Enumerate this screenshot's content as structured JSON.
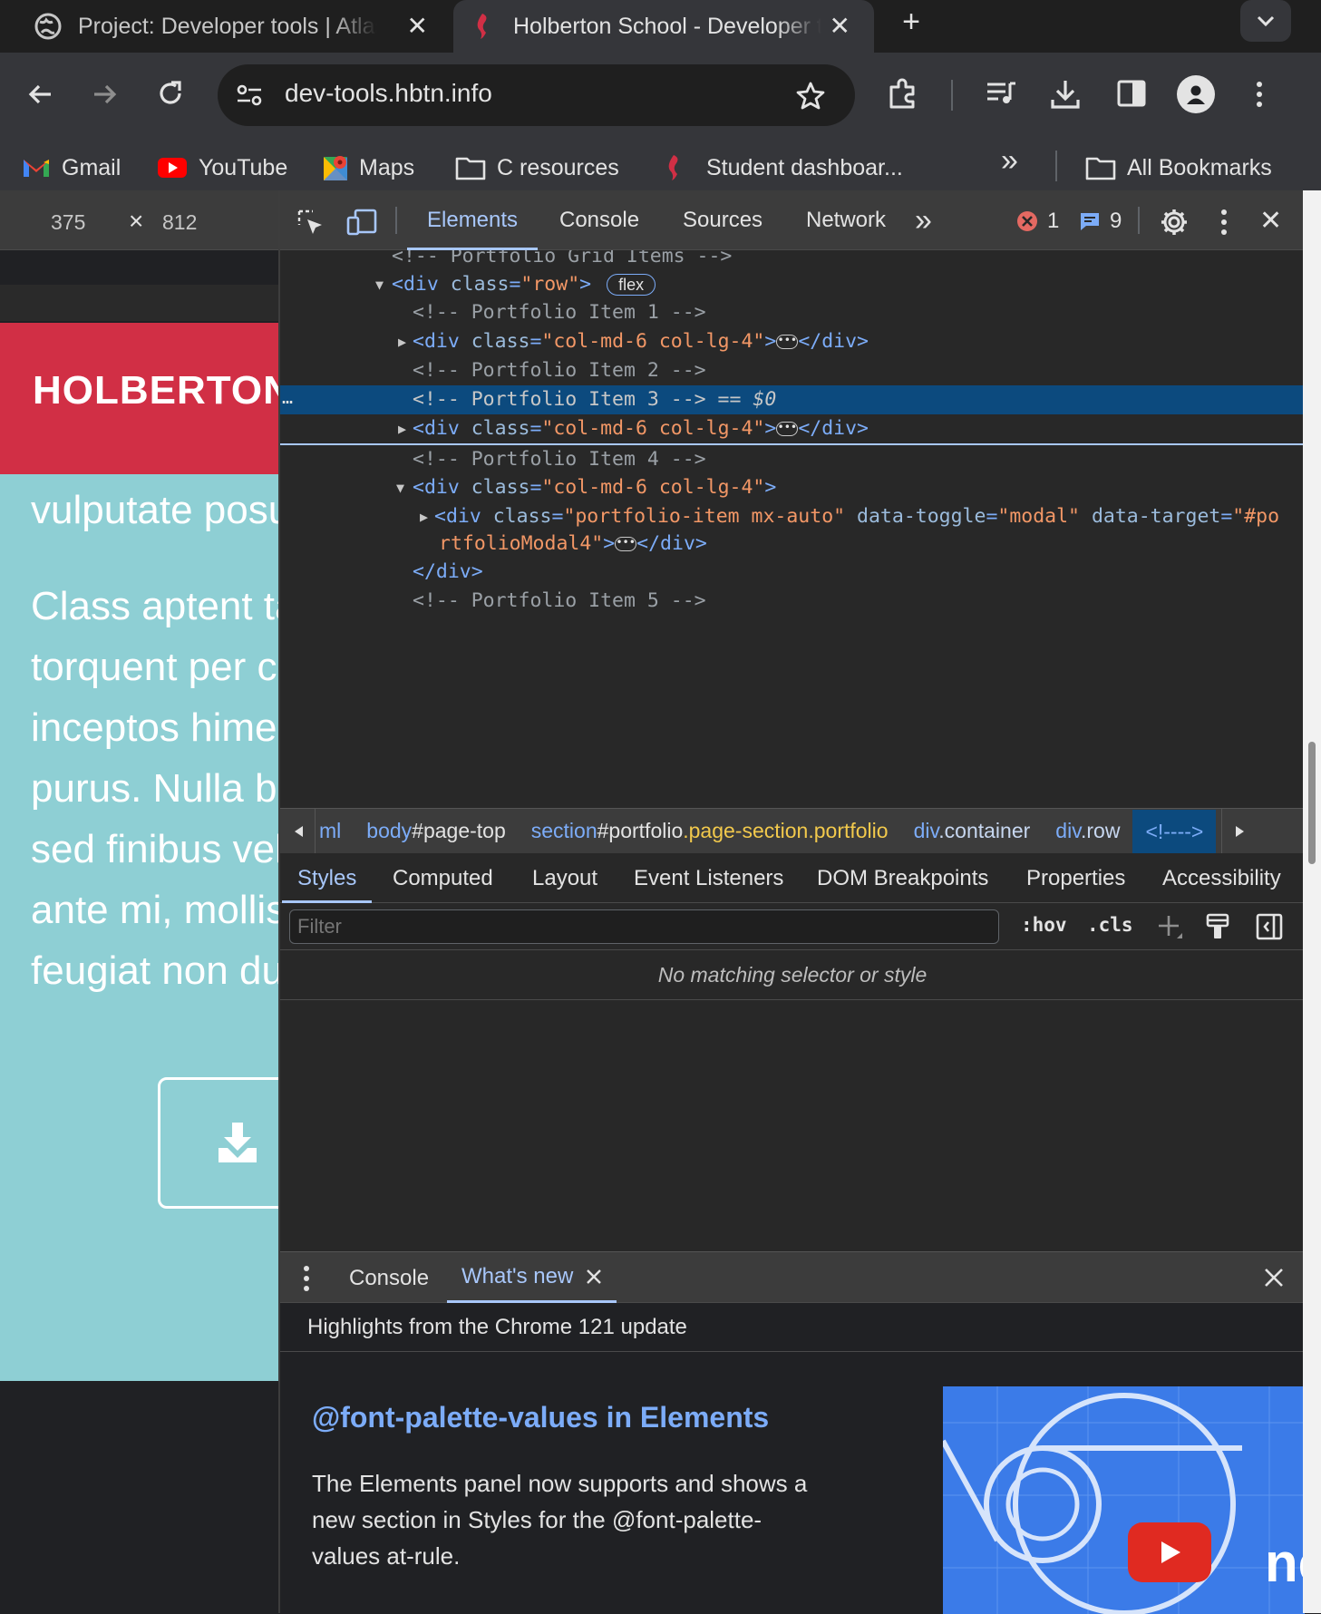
{
  "browser": {
    "tabs": [
      {
        "title": "Project: Developer tools | Atlas",
        "close": "✕"
      },
      {
        "title": "Holberton School - Developer tools",
        "close": "✕"
      }
    ],
    "new_tab": "+",
    "tab_menu": "⌄",
    "url": "dev-tools.hbtn.info",
    "bookmarks": [
      {
        "label": "Gmail",
        "icon": "gmail-icon"
      },
      {
        "label": "YouTube",
        "icon": "youtube-icon"
      },
      {
        "label": "Maps",
        "icon": "maps-icon"
      },
      {
        "label": "C resources",
        "icon": "folder-icon"
      },
      {
        "label": "Student dashboar...",
        "icon": "holberton-icon"
      }
    ],
    "more_bookmarks": "»",
    "all_bookmarks": "All Bookmarks"
  },
  "device_toolbar": {
    "width": "375",
    "times": "×",
    "height": "812"
  },
  "page": {
    "brand": "HOLBERTON",
    "subtitle": "vulputate posu",
    "paragraph_lines": [
      "Class aptent ta",
      "torquent per c",
      "inceptos hime",
      "purus. Nulla bi",
      "sed finibus vel",
      "ante mi, mollis",
      "feugiat non du"
    ]
  },
  "devtools": {
    "tabs": [
      "Elements",
      "Console",
      "Sources",
      "Network"
    ],
    "more_tabs": "»",
    "error_count": "1",
    "message_count": "9",
    "close": "✕",
    "tree": {
      "l0": "<!-- Portfolio Grid Items -->",
      "l1_tag": "<div ",
      "l1_attr": "class",
      "l1_val": "\"row\"",
      "l1_end": ">",
      "l1_badge": "flex",
      "l2": "<!-- Portfolio Item 1 -->",
      "col_tag": "<div ",
      "col_attr": "class",
      "col_val": "\"col-md-6 col-lg-4\"",
      "gt": ">",
      "close_div": "</div>",
      "l4": "<!-- Portfolio Item 2 -->",
      "l5": "<!-- Portfolio Item 3 -->",
      "l5_suffix": " == $0",
      "l7": "<!-- Portfolio Item 4 -->",
      "l9_attr1": "class",
      "l9_val1": "\"portfolio-item mx-auto\"",
      "l9_attr2": "data-toggle",
      "l9_val2": "\"modal\"",
      "l9_attr3": "data-target",
      "l9_val3a": "\"#po",
      "l10_val": "rtfolioModal4\"",
      "l12": "<!-- Portfolio Item 5 -->"
    },
    "breadcrumbs": [
      "ml",
      "body#page-top",
      "section#portfolio.page-section.portfolio",
      "div.container",
      "div.row",
      "<!---->"
    ],
    "crumb_parts": {
      "body_a": "body",
      "body_b": "#page-top",
      "sec_a": "section",
      "sec_b": "#portfolio",
      "sec_c": ".page-section.portfolio",
      "cont_a": "div",
      "cont_b": ".container",
      "row_a": "div",
      "row_b": ".row"
    },
    "subtabs": [
      "Styles",
      "Computed",
      "Layout",
      "Event Listeners",
      "DOM Breakpoints",
      "Properties",
      "Accessibility"
    ],
    "filter_placeholder": "Filter",
    "hov": ":hov",
    "cls": ".cls",
    "no_match": "No matching selector or style",
    "drawer": {
      "tabs": [
        "Console",
        "What's new"
      ],
      "highlights": "Highlights from the Chrome 121 update",
      "feature_title": "@font-palette-values in Elements",
      "feature_text_lines": [
        "The Elements panel now supports and shows a",
        "new section in Styles for the @font-palette-",
        "values at-rule."
      ],
      "thumb_text": "ne"
    }
  },
  "colors": {
    "accent": "#a8c7fa",
    "brand_red": "#d12f45",
    "page_teal": "#8ecfd4",
    "selection": "#0c4a7e"
  }
}
